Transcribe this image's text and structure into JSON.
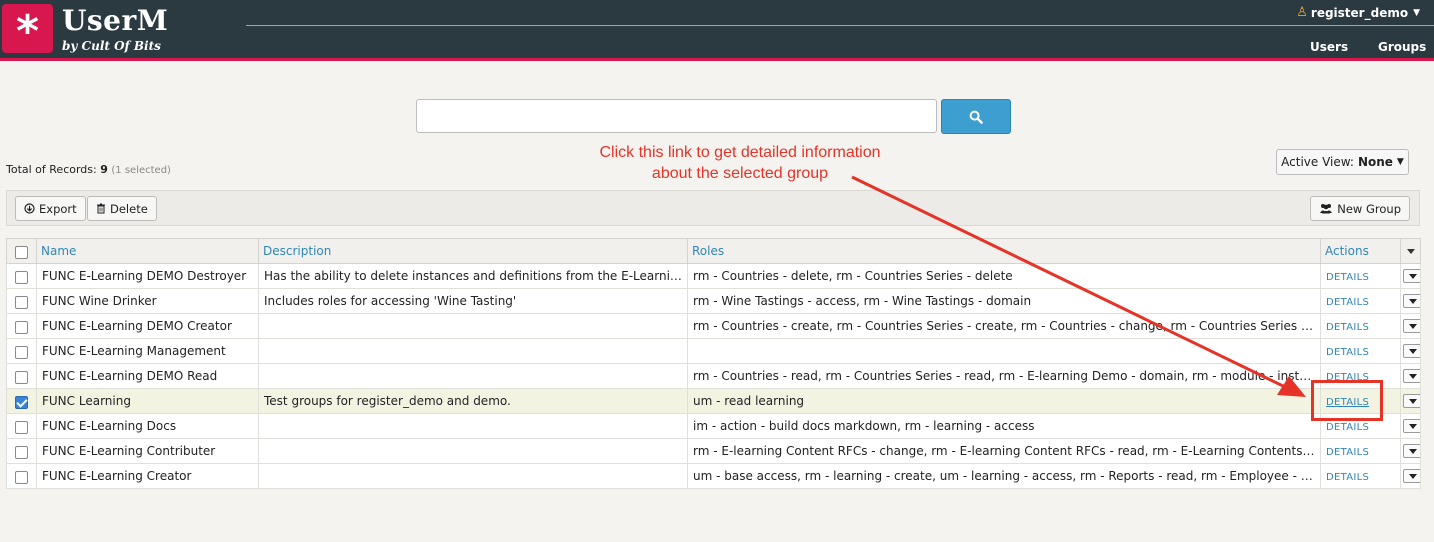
{
  "brand": {
    "logo_glyph": "*",
    "name": "UserM",
    "subtitle": "by Cult Of Bits"
  },
  "user_menu": {
    "username": "register_demo",
    "icon": "user-icon"
  },
  "nav": {
    "users": "Users",
    "groups": "Groups"
  },
  "search": {
    "value": "",
    "placeholder": "",
    "icon": "search-icon"
  },
  "summary": {
    "label": "Total of Records:",
    "count": "9",
    "selected": "(1 selected)"
  },
  "annotation": {
    "line1": "Click this link to get detailed information",
    "line2": "about the selected group"
  },
  "active_view": {
    "label": "Active View:",
    "value": "None"
  },
  "toolbar": {
    "export_label": "Export",
    "delete_label": "Delete",
    "new_group_label": "New Group"
  },
  "table": {
    "headers": {
      "name": "Name",
      "description": "Description",
      "roles": "Roles",
      "actions": "Actions"
    },
    "action_label": "DETAILS",
    "rows": [
      {
        "name": "FUNC E-Learning DEMO Destroyer",
        "description": "Has the ability to delete instances and definitions from the E-Learning Dem...",
        "roles": "rm - Countries - delete, rm - Countries Series - delete",
        "selected": false
      },
      {
        "name": "FUNC Wine Drinker",
        "description": "Includes roles for accessing 'Wine Tasting'",
        "roles": "rm - Wine Tastings - access, rm - Wine Tastings - domain",
        "selected": false
      },
      {
        "name": "FUNC E-Learning DEMO Creator",
        "description": "",
        "roles": "rm - Countries - create, rm - Countries Series - create, rm - Countries - change, rm - Countries Series - change, r...",
        "selected": false
      },
      {
        "name": "FUNC E-Learning Management",
        "description": "",
        "roles": "",
        "selected": false
      },
      {
        "name": "FUNC E-Learning DEMO Read",
        "description": "",
        "roles": "rm - Countries - read, rm - Countries Series - read, rm - E-learning Demo - domain, rm - module - instance details...",
        "selected": false
      },
      {
        "name": "FUNC Learning",
        "description": "Test groups for register_demo and demo.",
        "roles": "um - read learning",
        "selected": true
      },
      {
        "name": "FUNC E-Learning Docs",
        "description": "",
        "roles": "im - action - build docs markdown, rm - learning - access",
        "selected": false
      },
      {
        "name": "FUNC E-Learning Contributer",
        "description": "",
        "roles": "rm - E-learning Content RFCs - change, rm - E-learning Content RFCs - read, rm - E-Learning Contents - domain, R...",
        "selected": false
      },
      {
        "name": "FUNC E-Learning Creator",
        "description": "",
        "roles": "um - base access, rm - learning - create, um - learning - access, rm - Reports - read, rm - Employee - tasks",
        "selected": false
      }
    ]
  },
  "colors": {
    "header_bg": "#2b3a40",
    "brand_accent": "#d8174f",
    "link": "#3186b8",
    "annotation": "#e53327",
    "search_button": "#3d9fcf"
  }
}
